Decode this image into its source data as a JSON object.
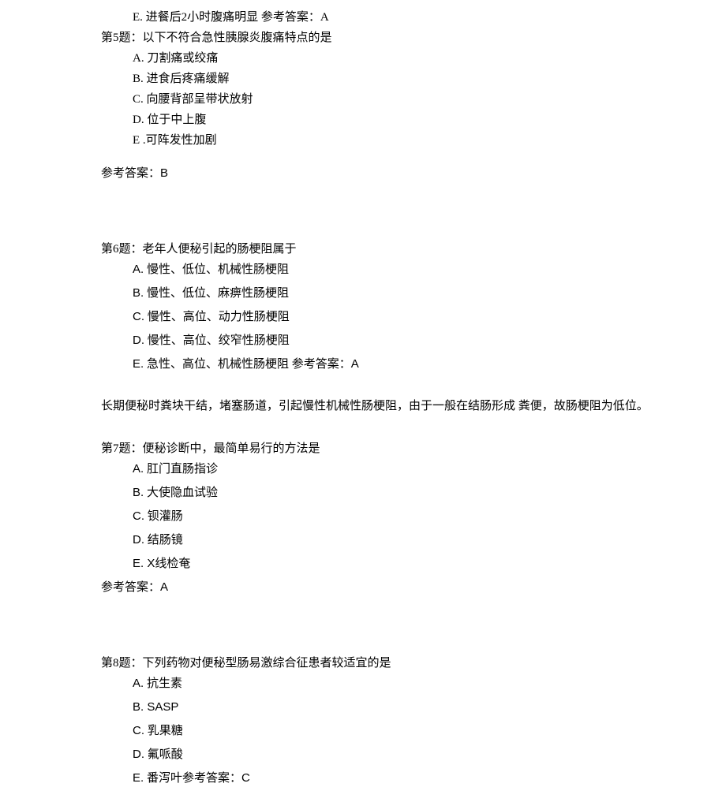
{
  "q4_remainder": {
    "option_e": "E. 进餐后2小时腹痛明显  参考答案：A"
  },
  "q5": {
    "title": "第5题：以下不符合急性胰腺炎腹痛特点的是",
    "options": {
      "a": "A. 刀割痛或绞痛",
      "b": "B. 进食后疼痛缓解",
      "c": "C. 向腰背部呈带状放射",
      "d": "D. 位于中上腹",
      "e": "E .可阵发性加剧"
    },
    "answer_label": "参考答案：",
    "answer_value": "B"
  },
  "q6": {
    "title": "第6题：老年人便秘引起的肠梗阻属于",
    "options": {
      "a_letter": "A.",
      "a_text": " 慢性、低位、机械性肠梗阻",
      "b_letter": "B.",
      "b_text": " 慢性、低位、麻痹性肠梗阻",
      "c_letter": "C.",
      "c_text": " 慢性、高位、动力性肠梗阻",
      "d_letter": "D.",
      "d_text": " 慢性、高位、绞窄性肠梗阻",
      "e_letter": "E.",
      "e_text": " 急性、高位、机械性肠梗阻  参考答案：",
      "e_answer": "A"
    },
    "explanation": "长期便秘时粪块干结，堵塞肠道，引起慢性机械性肠梗阻，由于一般在结肠形成 粪便，故肠梗阻为低位。"
  },
  "q7": {
    "title": "第7题：便秘诊断中，最简单易行的方法是",
    "options": {
      "a_letter": "A.",
      "a_text": " 肛门直肠指诊",
      "b_letter": "B.",
      "b_text": " 大使隐血试验",
      "c_letter": "C.",
      "c_text": " 钡灌肠",
      "d_letter": "D.",
      "d_text": " 结肠镜",
      "e_letter": "E.",
      "e_text_prefix": " X",
      "e_text_suffix": "线检奄"
    },
    "answer_label": "参考答案：",
    "answer_value": "A"
  },
  "q8": {
    "title": "第8题：下列药物对便秘型肠易激综合征患者较适宜的是",
    "options": {
      "a_letter": "A.",
      "a_text": " 抗生素",
      "b_letter": "B.",
      "b_text": " SASP",
      "c_letter": "C.",
      "c_text": " 乳果糖",
      "d_letter": "D.",
      "d_text": " 氟哌酸",
      "e_letter": "E.",
      "e_text": " 番泻叶参考答案：",
      "e_answer": "C"
    }
  }
}
